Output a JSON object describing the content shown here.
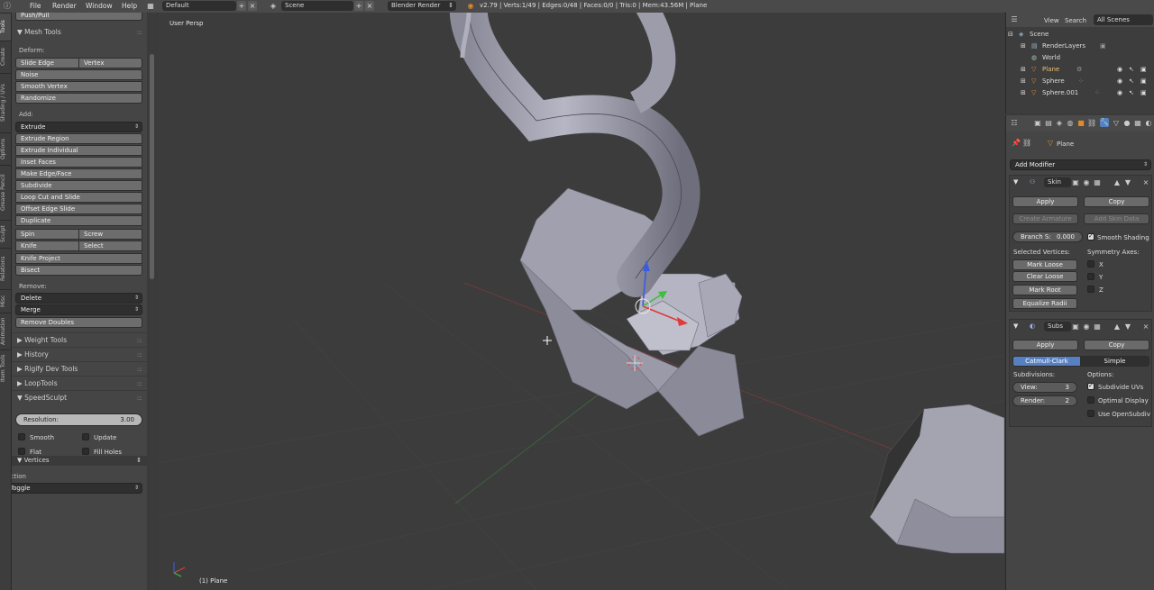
{
  "topbar": {
    "menus": [
      "File",
      "Render",
      "Window",
      "Help"
    ],
    "layout": "Default",
    "scene": "Scene",
    "engine": "Blender Render",
    "stats": "v2.79 | Verts:1/49 | Edges:0/48 | Faces:0/0 | Tris:0 | Mem:43.56M | Plane"
  },
  "lefttabs": [
    "Tools",
    "Create",
    "Shading / UVs",
    "Options",
    "Grease Pencil",
    "Sculpt",
    "Relations",
    "Misc",
    "Animation",
    "Item Tools"
  ],
  "tools": {
    "top_item": "Push/Pull",
    "mesh_tools": "Mesh Tools",
    "deform_label": "Deform:",
    "slide_edge": "Slide Edge",
    "vertex": "Vertex",
    "noise": "Noise",
    "smooth_vertex": "Smooth Vertex",
    "randomize": "Randomize",
    "add_label": "Add:",
    "extrude": "Extrude",
    "extrude_region": "Extrude Region",
    "extrude_individual": "Extrude Individual",
    "inset_faces": "Inset Faces",
    "make_edge_face": "Make Edge/Face",
    "subdivide": "Subdivide",
    "loop_cut": "Loop Cut and Slide",
    "offset_edge": "Offset Edge Slide",
    "duplicate": "Duplicate",
    "spin": "Spin",
    "screw": "Screw",
    "knife": "Knife",
    "select": "Select",
    "knife_project": "Knife Project",
    "bisect": "Bisect",
    "remove_label": "Remove:",
    "delete": "Delete",
    "merge": "Merge",
    "remove_doubles": "Remove Doubles",
    "sections": [
      "Weight Tools",
      "History",
      "Rigify Dev Tools",
      "LoopTools"
    ],
    "speedsculpt": "SpeedSculpt",
    "resolution_label": "Resolution:",
    "resolution_value": "3.00",
    "smooth": "Smooth",
    "update": "Update",
    "flat": "Flat",
    "fill_holes": "Fill Holes",
    "vertices": "Vertices",
    "action_label": "Action",
    "toggle": "Toggle"
  },
  "viewport": {
    "view_label": "User Persp",
    "object_label": "(1) Plane"
  },
  "outliner": {
    "view": "View",
    "search": "Search",
    "all_scenes": "All Scenes",
    "items": [
      "Scene",
      "RenderLayers",
      "World",
      "Plane",
      "Sphere",
      "Sphere.001"
    ]
  },
  "properties": {
    "object": "Plane",
    "add_modifier": "Add Modifier",
    "skin": {
      "name": "Skin",
      "apply": "Apply",
      "copy": "Copy",
      "create_armature": "Create Armature",
      "add_skin_data": "Add Skin Data",
      "branch_label": "Branch S:",
      "branch_value": "0.000",
      "smooth_shading": "Smooth Shading",
      "selected_vertices": "Selected Vertices:",
      "symmetry_axes": "Symmetry Axes:",
      "mark_loose": "Mark Loose",
      "clear_loose": "Clear Loose",
      "mark_root": "Mark Root",
      "equalize_radii": "Equalize Radii",
      "axes": [
        "X",
        "Y",
        "Z"
      ]
    },
    "subsurf": {
      "name": "Subs",
      "apply": "Apply",
      "copy": "Copy",
      "catmull": "Catmull-Clark",
      "simple": "Simple",
      "subdivisions": "Subdivisions:",
      "options": "Options:",
      "view_label": "View:",
      "view_value": "3",
      "render_label": "Render:",
      "render_value": "2",
      "subdivide_uvs": "Subdivide UVs",
      "optimal_display": "Optimal Display",
      "use_opensubdiv": "Use OpenSubdiv"
    }
  },
  "colors": {
    "accent": "#5680c2",
    "background": "#3c3c3c",
    "panel": "#454545"
  }
}
